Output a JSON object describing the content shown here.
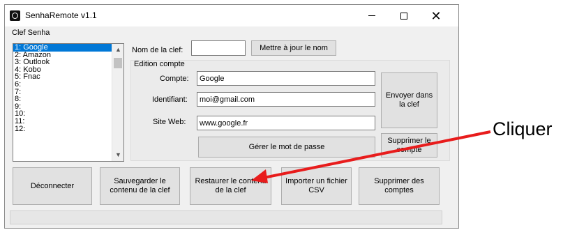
{
  "window": {
    "title": "SenhaRemote v1.1",
    "controls": {
      "minimize": "—",
      "maximize": "□",
      "close": "✕"
    }
  },
  "key_group": {
    "label": "Clef Senha",
    "items": [
      "1: Google",
      "2: Amazon",
      "3: Outlook",
      "4: Kobo",
      "5: Fnac",
      "6:",
      "7:",
      "8:",
      "9:",
      "10:",
      "11:",
      "12:"
    ],
    "selected_index": 0
  },
  "key_name": {
    "label": "Nom de la clef:",
    "value": "",
    "update_button": "Mettre à jour le nom"
  },
  "account_edit": {
    "group_label": "Edition compte",
    "account_label": "Compte:",
    "account_value": "Google",
    "identifier_label": "Identifiant:",
    "identifier_value": "moi@gmail.com",
    "website_label": "Site Web:",
    "website_value": "www.google.fr",
    "manage_password_button": "Gérer le mot de passe",
    "send_button": "Envoyer dans la clef",
    "delete_account_button": "Supprimer le compte"
  },
  "actions": {
    "disconnect": "Déconnecter",
    "save": "Sauvegarder le contenu de la clef",
    "restore": "Restaurer le contenu de la clef",
    "import_csv": "Importer un fichier CSV",
    "delete_accounts": "Supprimer des comptes"
  },
  "annotation": {
    "text": "Cliquer",
    "arrow_color": "#e81c1c"
  }
}
